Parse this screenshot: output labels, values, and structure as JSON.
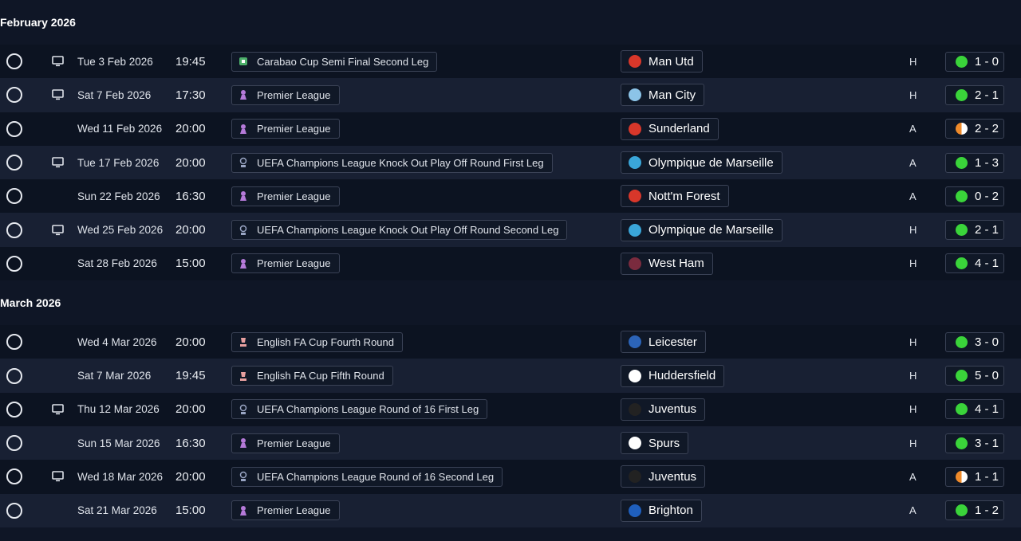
{
  "sections": [
    {
      "title": "February 2026",
      "rows": [
        {
          "tv": true,
          "date": "Tue 3 Feb 2026",
          "time": "19:45",
          "comp": "Carabao Cup Semi Final Second Leg",
          "comp_icon": "carabao-cup-icon",
          "team": "Man Utd",
          "team_color": "#d8372a",
          "venue": "H",
          "score": "1 - 0",
          "result": "win"
        },
        {
          "tv": true,
          "date": "Sat 7 Feb 2026",
          "time": "17:30",
          "comp": "Premier League",
          "comp_icon": "premier-league-icon",
          "team": "Man City",
          "team_color": "#8cc4e8",
          "venue": "H",
          "score": "2 - 1",
          "result": "win"
        },
        {
          "tv": false,
          "date": "Wed 11 Feb 2026",
          "time": "20:00",
          "comp": "Premier League",
          "comp_icon": "premier-league-icon",
          "team": "Sunderland",
          "team_color": "#d8372a",
          "venue": "A",
          "score": "2 - 2",
          "result": "draw"
        },
        {
          "tv": true,
          "date": "Tue 17 Feb 2026",
          "time": "20:00",
          "comp": "UEFA Champions League Knock Out Play Off Round First Leg",
          "comp_icon": "champions-league-icon",
          "team": "Olympique de Marseille",
          "team_color": "#3aa6d9",
          "venue": "A",
          "score": "1 - 3",
          "result": "win"
        },
        {
          "tv": false,
          "date": "Sun 22 Feb 2026",
          "time": "16:30",
          "comp": "Premier League",
          "comp_icon": "premier-league-icon",
          "team": "Nott'm Forest",
          "team_color": "#d8372a",
          "venue": "A",
          "score": "0 - 2",
          "result": "win"
        },
        {
          "tv": true,
          "date": "Wed 25 Feb 2026",
          "time": "20:00",
          "comp": "UEFA Champions League Knock Out Play Off Round Second Leg",
          "comp_icon": "champions-league-icon",
          "team": "Olympique de Marseille",
          "team_color": "#3aa6d9",
          "venue": "H",
          "score": "2 - 1",
          "result": "win"
        },
        {
          "tv": false,
          "date": "Sat 28 Feb 2026",
          "time": "15:00",
          "comp": "Premier League",
          "comp_icon": "premier-league-icon",
          "team": "West Ham",
          "team_color": "#7a2b3e",
          "venue": "H",
          "score": "4 - 1",
          "result": "win"
        }
      ]
    },
    {
      "title": "March 2026",
      "rows": [
        {
          "tv": false,
          "date": "Wed 4 Mar 2026",
          "time": "20:00",
          "comp": "English FA Cup Fourth Round",
          "comp_icon": "fa-cup-icon",
          "team": "Leicester",
          "team_color": "#2c64b8",
          "venue": "H",
          "score": "3 - 0",
          "result": "win"
        },
        {
          "tv": false,
          "date": "Sat 7 Mar 2026",
          "time": "19:45",
          "comp": "English FA Cup Fifth Round",
          "comp_icon": "fa-cup-icon",
          "team": "Huddersfield",
          "team_color": "#ffffff",
          "venue": "H",
          "score": "5 - 0",
          "result": "win"
        },
        {
          "tv": true,
          "date": "Thu 12 Mar 2026",
          "time": "20:00",
          "comp": "UEFA Champions League Round of 16  First Leg",
          "comp_icon": "champions-league-icon",
          "team": "Juventus",
          "team_color": "#222222",
          "venue": "H",
          "score": "4 - 1",
          "result": "win"
        },
        {
          "tv": false,
          "date": "Sun 15 Mar 2026",
          "time": "16:30",
          "comp": "Premier League",
          "comp_icon": "premier-league-icon",
          "team": "Spurs",
          "team_color": "#ffffff",
          "venue": "H",
          "score": "3 - 1",
          "result": "win"
        },
        {
          "tv": true,
          "date": "Wed 18 Mar 2026",
          "time": "20:00",
          "comp": "UEFA Champions League Round of 16  Second Leg",
          "comp_icon": "champions-league-icon",
          "team": "Juventus",
          "team_color": "#222222",
          "venue": "A",
          "score": "1 - 1",
          "result": "draw"
        },
        {
          "tv": false,
          "date": "Sat 21 Mar 2026",
          "time": "15:00",
          "comp": "Premier League",
          "comp_icon": "premier-league-icon",
          "team": "Brighton",
          "team_color": "#1f5fbd",
          "venue": "A",
          "score": "1 - 2",
          "result": "win"
        }
      ]
    }
  ],
  "colors": {
    "win": "#3ad43a",
    "draw": "#ef8a2a",
    "premier_league": "#b57ad9",
    "champions_league": "#9aa6c4",
    "fa_cup": "#e8a0a0",
    "carabao": "#4caf6a"
  }
}
